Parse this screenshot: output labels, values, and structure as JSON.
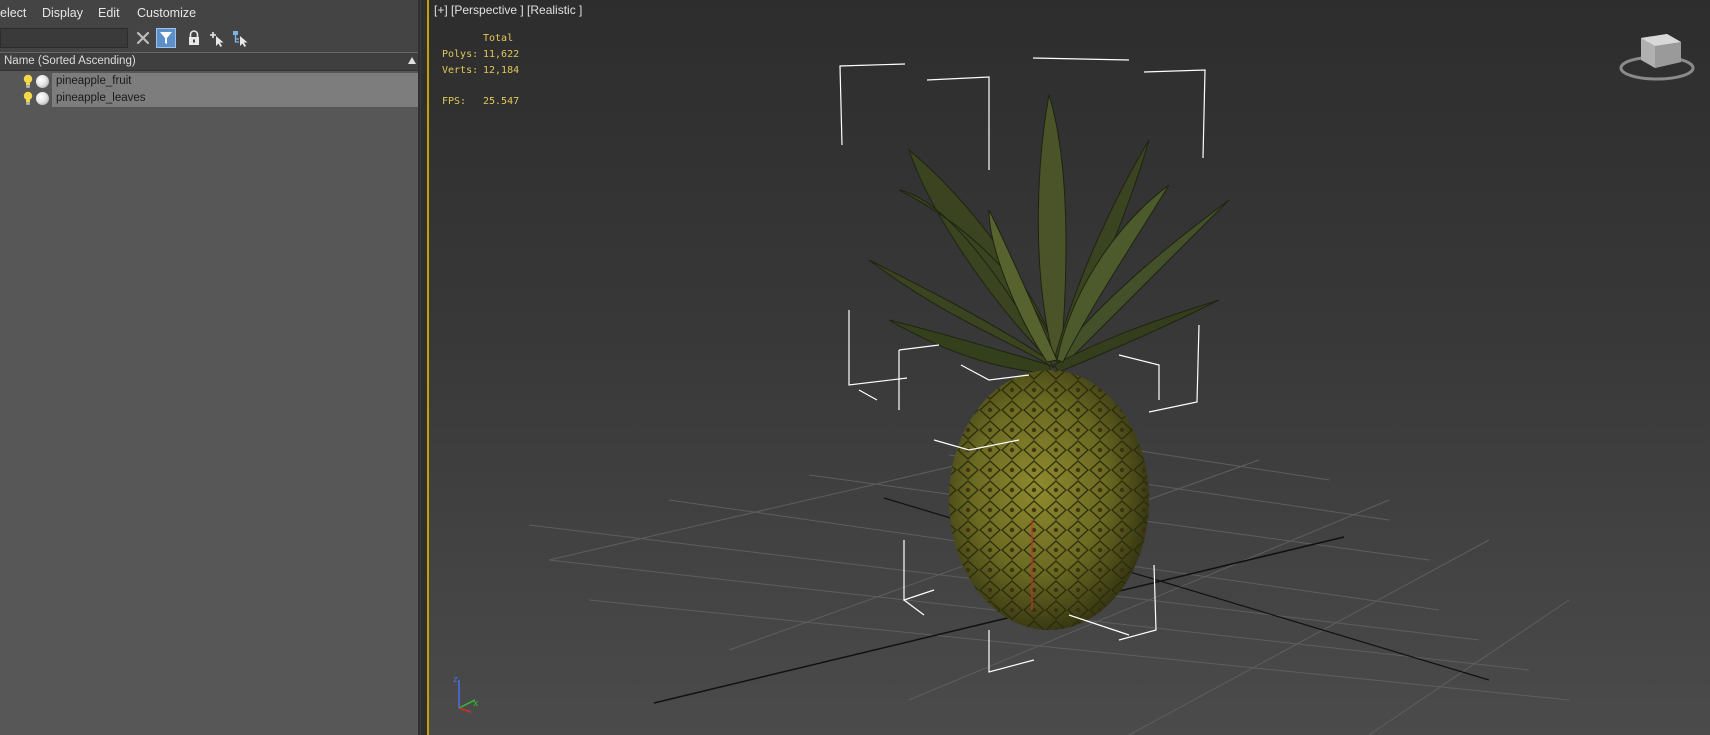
{
  "menu": {
    "select": "elect",
    "display": "Display",
    "edit": "Edit",
    "customize": "Customize"
  },
  "explorer": {
    "filter_value": "",
    "column_header": "Name (Sorted Ascending)",
    "items": [
      {
        "label": "pineapple_fruit"
      },
      {
        "label": "pineapple_leaves"
      }
    ]
  },
  "viewport": {
    "label": "[+] [Perspective ] [Realistic ]",
    "stats": {
      "total_label": "Total",
      "polys_label": "Polys:",
      "polys_value": "11,622",
      "verts_label": "Verts:",
      "verts_value": "12,184",
      "fps_label": "FPS:",
      "fps_value": "25.547"
    },
    "axis": {
      "z": "z",
      "x": "x"
    }
  },
  "colors": {
    "accent_border": "#c8a000",
    "stats_text": "#e2c85a",
    "selection": "#7d7d7d"
  }
}
